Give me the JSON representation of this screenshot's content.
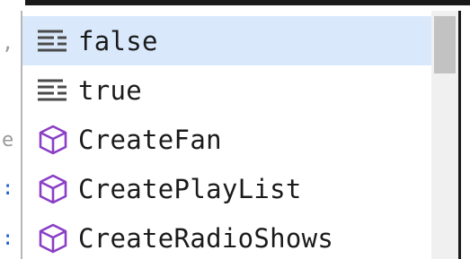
{
  "colors": {
    "selected_bg": "#d9e9fb",
    "method_icon": "#8a3fc6",
    "keyword_icon": "#4a4a4a",
    "text": "#1b1b1b"
  },
  "completion_list": {
    "items": [
      {
        "label": "false",
        "icon": "keyword-icon",
        "selected": true
      },
      {
        "label": "true",
        "icon": "keyword-icon",
        "selected": false
      },
      {
        "label": "CreateFan",
        "icon": "method-cube-icon",
        "selected": false
      },
      {
        "label": "CreatePlayList",
        "icon": "method-cube-icon",
        "selected": false
      },
      {
        "label": "CreateRadioShows",
        "icon": "method-cube-icon",
        "selected": false
      }
    ]
  }
}
